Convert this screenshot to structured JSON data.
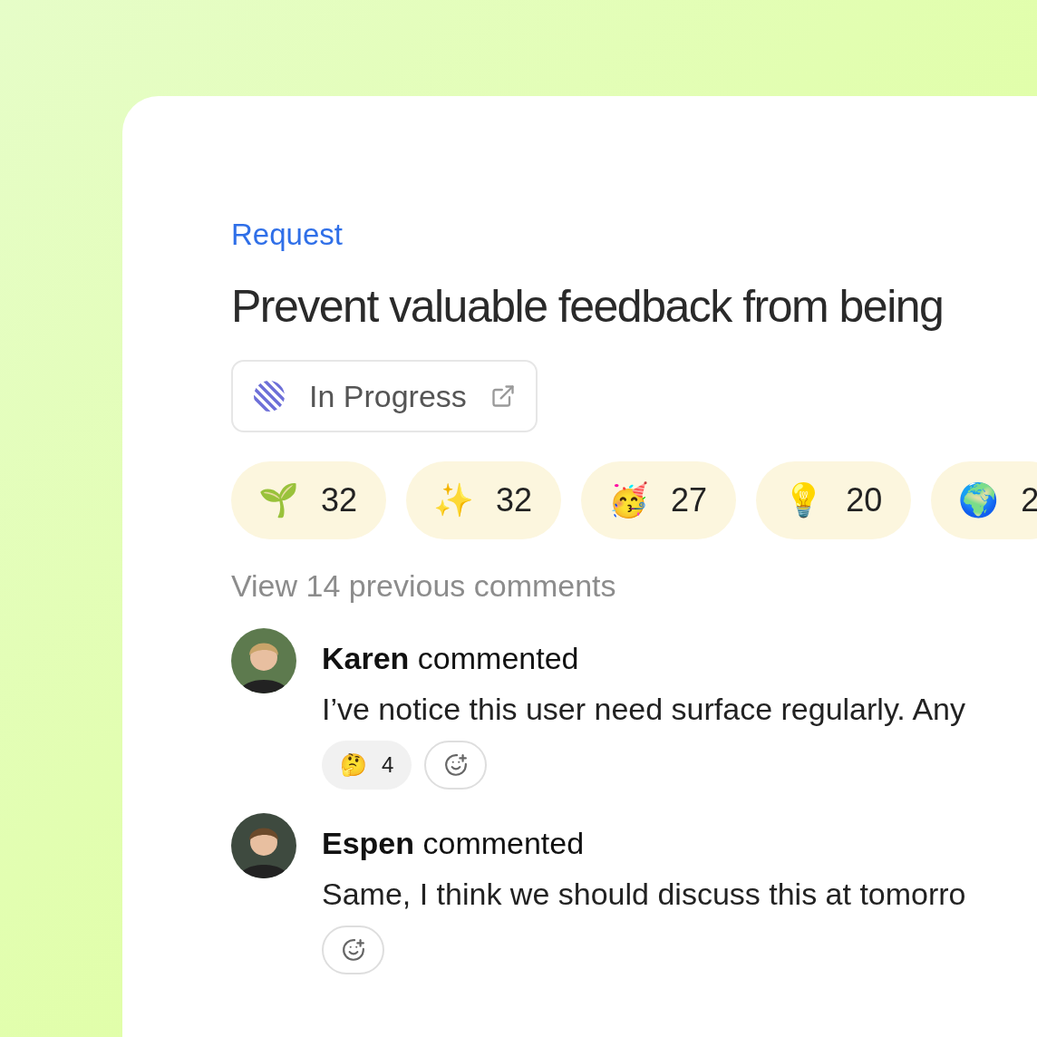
{
  "category": "Request",
  "title": "Prevent valuable feedback from being",
  "status": {
    "label": "In Progress"
  },
  "reactions": [
    {
      "emoji": "🌱",
      "count": "32"
    },
    {
      "emoji": "✨",
      "count": "32"
    },
    {
      "emoji": "🥳",
      "count": "27"
    },
    {
      "emoji": "💡",
      "count": "20"
    },
    {
      "emoji": "🌍",
      "count": "2"
    }
  ],
  "previous_comments": "View 14 previous comments",
  "comments": [
    {
      "author": "Karen",
      "action": "commented",
      "text": "I’ve notice this user need surface regularly. Any",
      "reactions": [
        {
          "emoji": "🤔",
          "count": "4"
        }
      ]
    },
    {
      "author": "Espen",
      "action": "commented",
      "text": "Same, I think we should discuss this at tomorro"
    }
  ]
}
